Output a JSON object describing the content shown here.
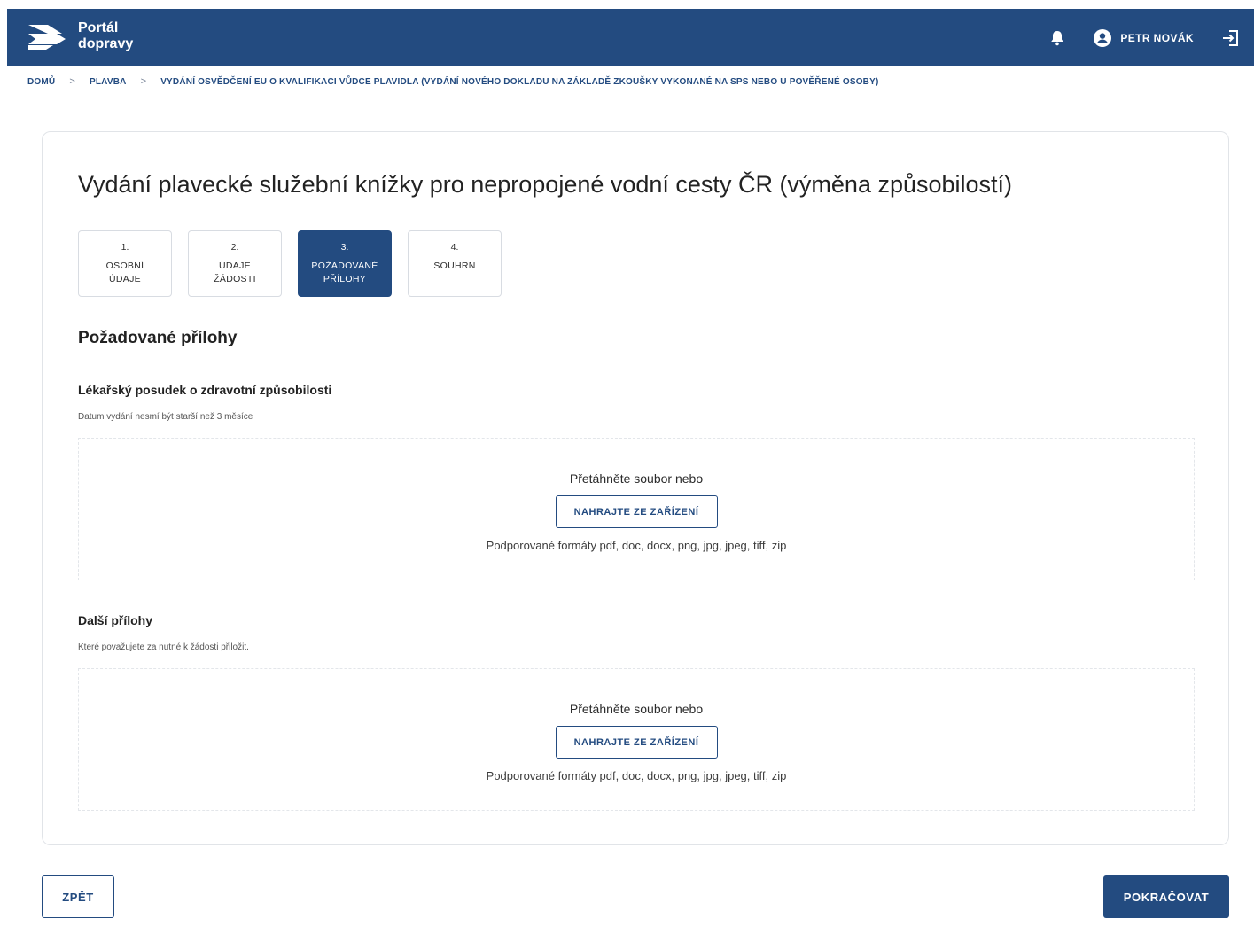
{
  "header": {
    "logo_line1": "Portál",
    "logo_line2": "dopravy",
    "user_name": "PETR NOVÁK",
    "icons": [
      "portal-logo",
      "bell-icon",
      "user-avatar-icon",
      "logout-icon"
    ],
    "bg_color": "#234b80"
  },
  "breadcrumb": {
    "items": [
      "DOMŮ",
      "PLAVBA",
      "VYDÁNÍ OSVĚDČENÍ EU O KVALIFIKACI VŮDCE PLAVIDLA (VYDÁNÍ NOVÉHO DOKLADU NA ZÁKLADĚ ZKOUŠKY VYKONANÉ NA SPS NEBO U POVĚŘENÉ OSOBY)"
    ],
    "separator": ">"
  },
  "main": {
    "title": "Vydání plavecké služební knížky pro nepropojené vodní cesty ČR (výměna způsobilostí)",
    "steps": [
      {
        "num": "1.",
        "label": "OSOBNÍ\nÚDAJE",
        "active": false
      },
      {
        "num": "2.",
        "label": "ÚDAJE\nŽÁDOSTI",
        "active": false
      },
      {
        "num": "3.",
        "label": "POŽADOVANÉ\nPŘÍLOHY",
        "active": true
      },
      {
        "num": "4.",
        "label": "SOUHRN",
        "active": false
      }
    ],
    "section_title": "Požadované přílohy",
    "groups": [
      {
        "title": "Lékařský posudek o zdravotní způsobilosti",
        "description": "Datum vydání nesmí být starší než 3 měsíce",
        "drop_text": "Přetáhněte soubor nebo",
        "upload_label": "NAHRAJTE ZE ZAŘÍZENÍ",
        "formats": "Podporované formáty pdf, doc, docx, png, jpg, jpeg, tiff, zip"
      },
      {
        "title": "Další přílohy",
        "description": "Které považujete za nutné k žádosti přiložit.",
        "drop_text": "Přetáhněte soubor nebo",
        "upload_label": "NAHRAJTE ZE ZAŘÍZENÍ",
        "formats": "Podporované formáty pdf, doc, docx, png, jpg, jpeg, tiff, zip"
      }
    ]
  },
  "footer": {
    "back_label": "ZPĚT",
    "next_label": "POKRAČOVAT"
  },
  "colors": {
    "primary": "#234b80",
    "border": "#d8dce2"
  }
}
